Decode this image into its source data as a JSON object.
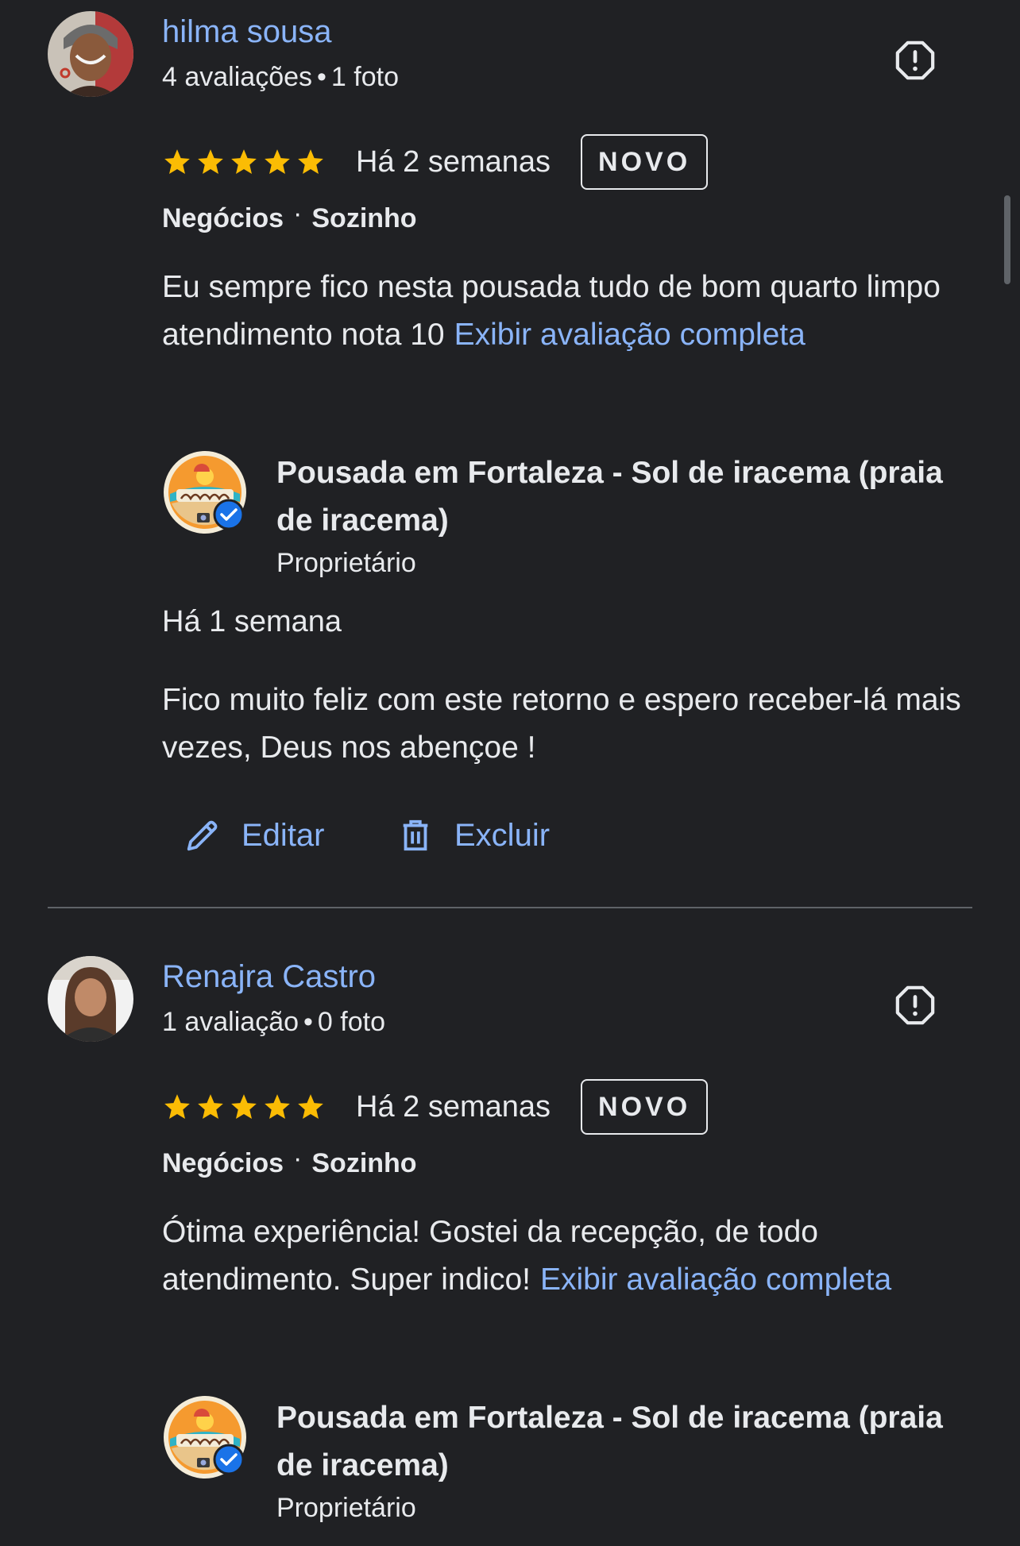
{
  "reviews": [
    {
      "reviewer": {
        "name": "hilma sousa",
        "review_count": "4 avaliações",
        "meta_separator": "•",
        "photo_count": "1 foto",
        "avatar_icon": "avatar-photo"
      },
      "rating": {
        "stars": 5,
        "max": 5
      },
      "date": "Há 2 semanas",
      "badge": "NOVO",
      "trip_type": "Negócios",
      "tag_separator": "·",
      "companions": "Sozinho",
      "text": "Eu sempre fico nesta pousada tudo de bom quarto limpo atendimento nota 10",
      "more_label": "Exibir avaliação completa",
      "owner_response": {
        "business_name": "Pousada em Fortaleza - Sol de iracema (praia de iracema)",
        "role": "Proprietário",
        "logo_icon": "pousada-logo-verified",
        "date": "Há 1 semana",
        "text": "Fico muito feliz com este retorno e espero receber-lá mais vezes, Deus nos abençoe !"
      },
      "actions": {
        "edit_label": "Editar",
        "delete_label": "Excluir"
      }
    },
    {
      "reviewer": {
        "name": "Renajra Castro",
        "review_count": "1 avaliação",
        "meta_separator": "•",
        "photo_count": "0 foto",
        "avatar_icon": "avatar-photo"
      },
      "rating": {
        "stars": 5,
        "max": 5
      },
      "date": "Há 2 semanas",
      "badge": "NOVO",
      "trip_type": "Negócios",
      "tag_separator": "·",
      "companions": "Sozinho",
      "text": "Ótima experiência! Gostei da recepção, de todo atendimento. Super indico!",
      "more_label": "Exibir avaliação completa",
      "owner_response": {
        "business_name": "Pousada em Fortaleza - Sol de iracema (praia de iracema)",
        "role": "Proprietário",
        "logo_icon": "pousada-logo-verified"
      }
    }
  ],
  "colors": {
    "background": "#202124",
    "text": "#e8eaed",
    "link": "#8ab4f8",
    "star": "#fbbc04",
    "divider": "#5f6368",
    "verified": "#1a73e8"
  }
}
